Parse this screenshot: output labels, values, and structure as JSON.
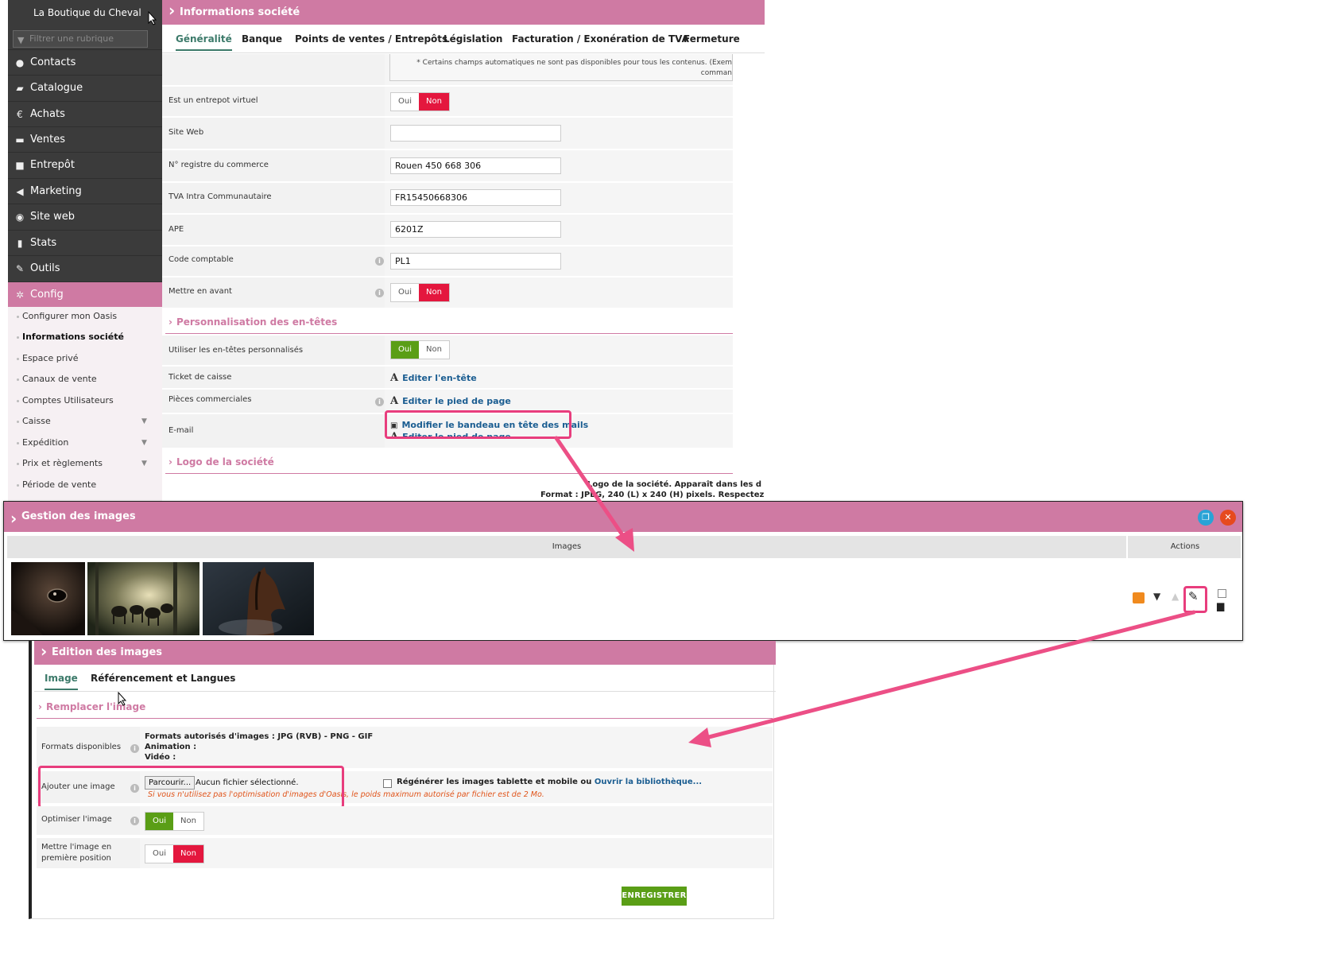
{
  "sidebar": {
    "brand": "La Boutique du Cheval",
    "filter_placeholder": "Filtrer une rubrique",
    "items": [
      {
        "label": "Contacts",
        "icon": "user-icon"
      },
      {
        "label": "Catalogue",
        "icon": "book-icon"
      },
      {
        "label": "Achats",
        "icon": "euro-icon"
      },
      {
        "label": "Ventes",
        "icon": "cart-icon"
      },
      {
        "label": "Entrepôt",
        "icon": "box-icon"
      },
      {
        "label": "Marketing",
        "icon": "megaphone-icon"
      },
      {
        "label": "Site web",
        "icon": "globe-icon"
      },
      {
        "label": "Stats",
        "icon": "bar-chart-icon"
      },
      {
        "label": "Outils",
        "icon": "wrench-icon"
      },
      {
        "label": "Config",
        "icon": "gear-icon"
      }
    ],
    "subitems": [
      "Configurer mon Oasis",
      "Informations société",
      "Espace privé",
      "Canaux de vente",
      "Comptes Utilisateurs",
      "Caisse",
      "Expédition",
      "Prix et règlements",
      "Période de vente"
    ]
  },
  "main": {
    "title": "Informations société",
    "tabs": [
      "Généralité",
      "Banque",
      "Points de ventes / Entrepôts",
      "Législation",
      "Facturation / Exonération de TVA",
      "Fermeture"
    ],
    "note_line1": "* Certains champs automatiques ne sont pas disponibles pour tous les contenus. (Exem",
    "note_line2": "comman",
    "fields": {
      "entrepot_virtuel": "Est un entrepot virtuel",
      "site_web": "Site Web",
      "site_web_value": "",
      "registre": "N° registre du commerce",
      "registre_value": "Rouen 450 668 306",
      "tva": "TVA Intra Communautaire",
      "tva_value": "FR15450668306",
      "ape": "APE",
      "ape_value": "6201Z",
      "code_comptable": "Code comptable",
      "code_comptable_value": "PL1",
      "mettre_en_avant": "Mettre en avant"
    },
    "yes": "Oui",
    "no": "Non",
    "section_entetes": "Personnalisation des en-têtes",
    "entetes": {
      "utiliser": "Utiliser les en-têtes personnalisés",
      "ticket": "Ticket de caisse",
      "ticket_link": "Editer l'en-tête",
      "pieces": "Pièces commerciales",
      "pieces_link": "Editer le pied de page",
      "email": "E-mail",
      "email_link1": "Modifier le bandeau en tête des mails",
      "email_link2": "Editer le pied de page"
    },
    "section_logo": "Logo de la société",
    "logo_line1": "Logo de la société. Apparaît dans les d",
    "logo_line2": "Format : JPEG, 240 (L) x 240 (H) pixels. Respectez"
  },
  "gestion": {
    "title": "Gestion des images",
    "col_images": "Images",
    "col_actions": "Actions"
  },
  "edition": {
    "title": "Edition des images",
    "tabs": [
      "Image",
      "Référencement et Langues"
    ],
    "section": "Remplacer l'image",
    "formats_label": "Formats disponibles",
    "formats_line1": "Formats autorisés d'images : JPG (RVB) - PNG - GIF",
    "formats_line2": "Animation :",
    "formats_line3": "Vidéo :",
    "ajouter_label": "Ajouter une image",
    "browse_button": "Parcourir...",
    "no_file": "Aucun fichier sélectionné.",
    "regen_label": "Régénérer les images tablette et mobile ou",
    "library_link": "Ouvrir la bibliothèque...",
    "warning": "Si vous n'utilisez pas l'optimisation d'images d'Oasis, le poids maximum autorisé par fichier est de 2 Mo.",
    "optimiser_label": "Optimiser l'image",
    "premiere_label_1": "Mettre l'image en",
    "premiere_label_2": "première position",
    "save_button": "ENREGISTRER"
  },
  "colors": {
    "accent": "#cf7aa3",
    "sidebar_bg": "#3b3b3b",
    "red": "#e4173e",
    "green": "#5a9e16",
    "link": "#1a5d91",
    "highlight": "#e83d7d"
  }
}
